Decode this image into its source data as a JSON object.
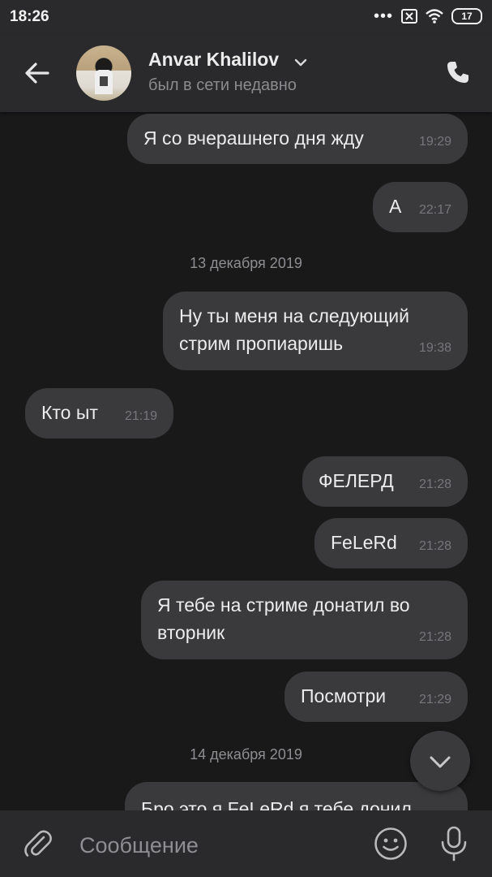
{
  "status_bar": {
    "time": "18:26",
    "battery": "17"
  },
  "header": {
    "name": "Anvar Khalilov",
    "status": "был в сети недавно"
  },
  "messages": [
    {
      "text": "Я со вчерашнего дня жду",
      "time": "19:29",
      "outgoing": true
    },
    {
      "text": "А",
      "time": "22:17",
      "outgoing": true
    },
    {
      "date": "13 декабря 2019"
    },
    {
      "text": "Ну ты меня на следующий\nстрим пропиаришь",
      "time": "19:38",
      "outgoing": true
    },
    {
      "text": "Кто ыт",
      "time": "21:19",
      "outgoing": false
    },
    {
      "text": "ФЕЛЕРД",
      "time": "21:28",
      "outgoing": true
    },
    {
      "text": "FeLeRd",
      "time": "21:28",
      "outgoing": true
    },
    {
      "text": "Я тебе на стриме донатил во\nвторник",
      "time": "21:28",
      "outgoing": true
    },
    {
      "text": "Посмотри",
      "time": "21:29",
      "outgoing": true
    },
    {
      "date": "14 декабря 2019"
    },
    {
      "text": "Бро это я FeLeRd я тебе донил",
      "time": "",
      "outgoing": true
    }
  ],
  "composer": {
    "placeholder": "Сообщение"
  },
  "icons": {
    "back": "arrow-left-icon",
    "dropdown": "chevron-down-icon",
    "call": "phone-icon",
    "scroll": "chevron-down-icon",
    "attach": "paperclip-icon",
    "emoji": "smiley-icon",
    "mic": "microphone-icon"
  },
  "colors": {
    "background": "#19191a",
    "bar": "#2a2a2c",
    "bubble": "#3a3a3c",
    "text": "#ececec",
    "muted": "#8c8c8f"
  }
}
